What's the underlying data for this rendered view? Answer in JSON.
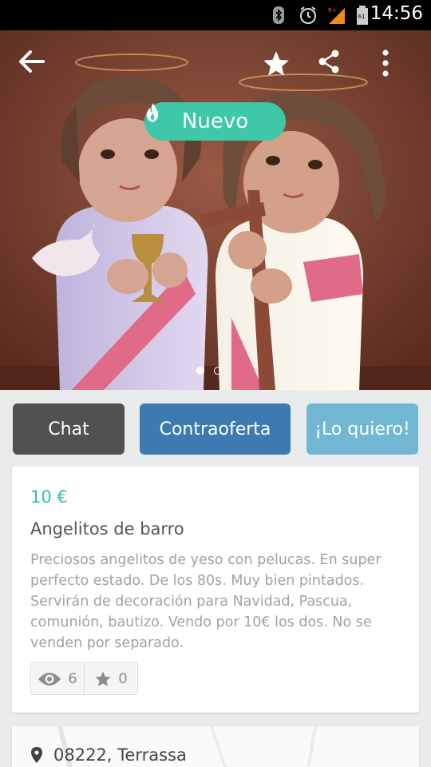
{
  "status_bar": {
    "time": "14:56",
    "icons": [
      "bluetooth-icon",
      "alarm-icon",
      "signal-icon",
      "battery-icon"
    ]
  },
  "header": {
    "back": "back-arrow-icon",
    "favorite": "star-icon",
    "share": "share-icon",
    "more": "more-vert-icon"
  },
  "badge": {
    "label": "Nuevo",
    "icon": "flame-icon",
    "color": "#3ec7a8"
  },
  "gallery": {
    "pages": 2,
    "current": 1
  },
  "actions": {
    "chat": "Chat",
    "counteroffer": "Contraoferta",
    "want": "¡Lo quiero!"
  },
  "listing": {
    "price": "10 €",
    "title": "Angelitos de barro",
    "description": "Preciosos angelitos de yeso con pelucas. En super perfecto estado. De los 80s. Muy bien pintados. Servirán de decoración para Navidad, Pascua, comunión, bautizo. Vendo por 10€ los dos. No se venden por separado.",
    "views": "6",
    "favorites": "0"
  },
  "location": {
    "text": "08222, Terrassa"
  },
  "colors": {
    "chat": "#505153",
    "counteroffer": "#3c7ab0",
    "want": "#71b7d4",
    "price": "#35b9c1"
  }
}
